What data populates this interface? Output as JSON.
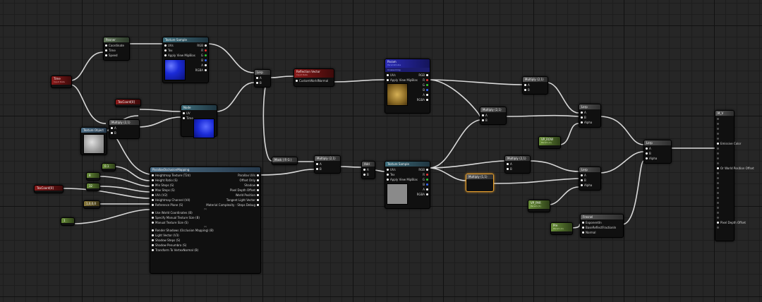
{
  "nodes": {
    "panner": {
      "title": "Panner",
      "pins": [
        "Coordinate",
        "Time",
        "Speed"
      ]
    },
    "tex1": {
      "title": "Texture Sample",
      "pins": [
        "UVs",
        "Tex",
        "Apply View MipBias"
      ],
      "outs": [
        "RGB",
        "R",
        "G",
        "B",
        "A",
        "RGBA"
      ]
    },
    "time": {
      "title": "Time",
      "sub": "Input Data"
    },
    "texcoord1": {
      "title": "TexCoord[0]"
    },
    "texobj": {
      "title": "Texture Object"
    },
    "mult1": {
      "title": "Multiply (2,1)",
      "pins": [
        "A",
        "B"
      ]
    },
    "node_mid": {
      "title": "Node",
      "pins": [
        "UV",
        "Time"
      ]
    },
    "lerp_small": {
      "title": "Lerp",
      "pins": [
        "A",
        "B"
      ]
    },
    "reflection": {
      "title": "Reflection Vector",
      "sub": "Input Data",
      "pins": [
        "CustomWorldNormal"
      ]
    },
    "param_tex": {
      "title": "Param",
      "sub": "Param2Cube",
      "pins": [
        "UVs",
        "Apply View MipBias"
      ],
      "outs": [
        "RGB",
        "R",
        "G",
        "B",
        "A",
        "RGBA"
      ],
      "label": "Unassuming"
    },
    "mult_tr": {
      "title": "Multiply (2,1)",
      "pins": [
        "A",
        "B"
      ]
    },
    "mult_mid": {
      "title": "Multiply (2,1)",
      "pins": [
        "A",
        "B"
      ]
    },
    "lerp1": {
      "title": "Lerp",
      "pins": [
        "A",
        "B",
        "Alpha"
      ]
    },
    "vp_1": {
      "title": "VP_ROW",
      "sub": "Param (1)"
    },
    "lerp_main": {
      "title": "Lerp",
      "pins": [
        "A",
        "B",
        "Alpha"
      ]
    },
    "mult_mid2": {
      "title": "Multiply (2,1)",
      "pins": [
        "A",
        "B"
      ]
    },
    "result": {
      "title": "M_V",
      "pins": [
        "Emissive Color",
        "Or World Position Offset",
        "Pixel Depth Offset"
      ]
    },
    "mask": {
      "title": "Mask ( R G )"
    },
    "mult_c": {
      "title": "Multiply (2,1)",
      "pins": [
        "A",
        "B"
      ]
    },
    "add": {
      "title": "Add",
      "pins": [
        "A",
        "B"
      ]
    },
    "tex2": {
      "title": "Texture Sample",
      "pins": [
        "UVs",
        "Tex",
        "Apply View MipBias"
      ],
      "outs": [
        "RGB",
        "R",
        "G",
        "B",
        "A",
        "RGBA"
      ]
    },
    "mult_sel": {
      "title": "Multiply (1,1)"
    },
    "mult_r": {
      "title": "Multiply (2,1)",
      "pins": [
        "A",
        "B"
      ]
    },
    "lerp2": {
      "title": "Lerp",
      "pins": [
        "A",
        "B",
        "Alpha"
      ]
    },
    "vp_2": {
      "title": "VP_PAR",
      "sub": "Param (1)"
    },
    "fresnel": {
      "title": "Fresnel",
      "pins": [
        "ExponentIn",
        "BaseReflectFractionIn",
        "Normal"
      ]
    },
    "param_bot": {
      "title": "Pre",
      "sub": "Param (1)"
    },
    "pom": {
      "title": "ParallaxOcclusionMapping",
      "ins": [
        "Heightmap Texture (T2d)",
        "Height Ratio (S)",
        "Min Steps (S)",
        "Max Steps (S)",
        "UVs (V2)",
        "Heightmap Channel (V4)",
        "Reference Plane (S)"
      ],
      "sep1": "(S)",
      "ins2": [
        "Use World Coordinates (B)",
        "Specify Manual Texture Size (B)",
        "Manual Texture Size (S)"
      ],
      "sep2": "(S)",
      "ins3": [
        "Render Shadows (Occlusion Mapping) (B)",
        "Light Vector (V3)",
        "Shadow Steps (S)",
        "Shadow Penumbra (S)",
        "Transform To VertexNormal (B)"
      ],
      "outs": [
        "Parallax UVs",
        "Offset Only",
        "Shadow",
        "Pixel Depth Offset",
        "World Position",
        "Tangent Light Vector",
        "Material Complexity - Steps Debug"
      ]
    },
    "const1": {
      "title": "0.1"
    },
    "const2": {
      "title": "8"
    },
    "const3": {
      "title": "32"
    },
    "const4": {
      "title": "1,0,0,0"
    },
    "const5": {
      "title": "1"
    },
    "texcoord2": {
      "title": "TexCoord[0]"
    }
  }
}
